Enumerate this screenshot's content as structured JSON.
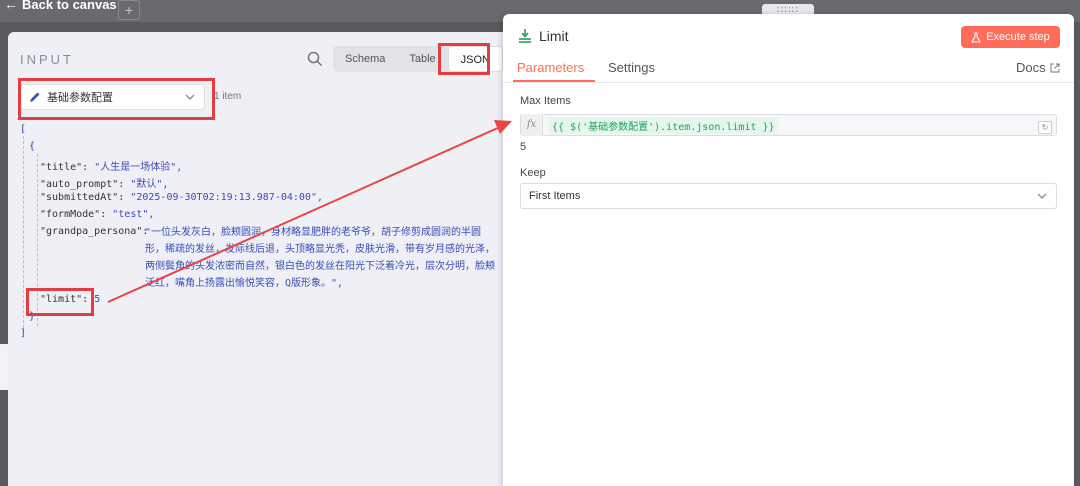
{
  "canvas": {
    "back_label": "Back to canvas",
    "add_label": "+",
    "drag_handle": "∷∷∷"
  },
  "input_panel": {
    "title": "INPUT",
    "view_tabs": [
      "Schema",
      "Table",
      "JSON"
    ],
    "active_view": "JSON",
    "node_select": "基础参数配置",
    "item_count": "1 item",
    "json": {
      "open_bracket": "[",
      "open_brace": "{",
      "close_brace": "}",
      "close_bracket": "]",
      "fields": [
        {
          "key": "\"title\":",
          "value": "\"人生是一场体验\","
        },
        {
          "key": "\"auto_prompt\":",
          "value": "\"默认\","
        },
        {
          "key": "\"submittedAt\":",
          "value": "\"2025-09-30T02:19:13.987-04:00\","
        },
        {
          "key": "\"formMode\":",
          "value": "\"test\","
        },
        {
          "key": "\"grandpa_persona\":",
          "value": "\"一位头发灰白，脸颊圆润，身材略显肥胖的老爷爷，胡子修剪成圆润的半圆形，稀疏的发丝，发际线后退，头顶略显光秃，皮肤光滑，带有岁月感的光泽，两侧鬓角的头发浓密而自然，银白色的发丝在阳光下泛着冷光，层次分明，脸颊泛红，嘴角上扬露出愉悦笑容，Q版形象。\","
        },
        {
          "key": "\"limit\":",
          "value": "5"
        }
      ]
    }
  },
  "node": {
    "title": "Limit",
    "execute_label": "Execute step",
    "tabs": [
      "Parameters",
      "Settings"
    ],
    "active_tab": "Parameters",
    "docs_label": "Docs",
    "max_items_label": "Max Items",
    "fx_label": "fx",
    "expression": "{{ $('基础参数配置').item.json.limit }}",
    "expression_result": "5",
    "keep_label": "Keep",
    "keep_value": "First Items"
  },
  "colors": {
    "accent": "#ff6d5a",
    "highlight": "#e43d3d",
    "expression_green": "#23a35b",
    "json_value": "#3a4bbb"
  }
}
